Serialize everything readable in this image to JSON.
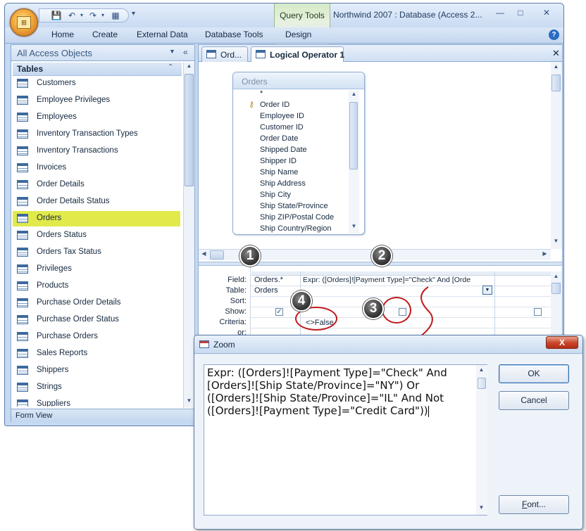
{
  "app": {
    "title": "Northwind 2007 : Database (Access 2...",
    "contextual_tab": "Query Tools",
    "ribbon_tabs": [
      "Home",
      "Create",
      "External Data",
      "Database Tools",
      "Design"
    ],
    "window_controls": {
      "minimize": "—",
      "maximize": "□",
      "close": "✕"
    },
    "help": "?"
  },
  "nav": {
    "title": "All Access Objects",
    "group": "Tables",
    "items": [
      {
        "label": "Customers",
        "selected": false
      },
      {
        "label": "Employee Privileges",
        "selected": false
      },
      {
        "label": "Employees",
        "selected": false
      },
      {
        "label": "Inventory Transaction Types",
        "selected": false
      },
      {
        "label": "Inventory Transactions",
        "selected": false
      },
      {
        "label": "Invoices",
        "selected": false
      },
      {
        "label": "Order Details",
        "selected": false
      },
      {
        "label": "Order Details Status",
        "selected": false
      },
      {
        "label": "Orders",
        "selected": true
      },
      {
        "label": "Orders Status",
        "selected": false
      },
      {
        "label": "Orders Tax Status",
        "selected": false
      },
      {
        "label": "Privileges",
        "selected": false
      },
      {
        "label": "Products",
        "selected": false
      },
      {
        "label": "Purchase Order Details",
        "selected": false
      },
      {
        "label": "Purchase Order Status",
        "selected": false
      },
      {
        "label": "Purchase Orders",
        "selected": false
      },
      {
        "label": "Sales Reports",
        "selected": false
      },
      {
        "label": "Shippers",
        "selected": false
      },
      {
        "label": "Strings",
        "selected": false
      },
      {
        "label": "Suppliers",
        "selected": false
      }
    ],
    "status": "Form View"
  },
  "doc_tabs": [
    {
      "label": "Ord...",
      "active": false
    },
    {
      "label": "Logical Operator 1",
      "active": true
    }
  ],
  "field_list": {
    "title": "Orders",
    "fields": [
      "*",
      "Order ID",
      "Employee ID",
      "Customer ID",
      "Order Date",
      "Shipped Date",
      "Shipper ID",
      "Ship Name",
      "Ship Address",
      "Ship City",
      "Ship State/Province",
      "Ship ZIP/Postal Code",
      "Ship Country/Region"
    ]
  },
  "qbe": {
    "row_labels": [
      "Field:",
      "Table:",
      "Sort:",
      "Show:",
      "Criteria:",
      "or:"
    ],
    "col1": {
      "field": "Orders.*",
      "table": "Orders",
      "show": true,
      "criteria": ""
    },
    "col2": {
      "field": "Expr: ([Orders]![Payment Type]=\"Check\" And [Orde",
      "table": "",
      "show": false,
      "criteria": "<>False"
    },
    "col3": {
      "show": false
    }
  },
  "callouts": [
    "1",
    "2",
    "3",
    "4"
  ],
  "zoom": {
    "title": "Zoom",
    "close": "X",
    "expression": "Expr: ([Orders]![Payment Type]=\"Check\" And [Orders]![Ship State/Province]=\"NY\") Or ([Orders]![Ship State/Province]=\"IL\" And Not ([Orders]![Payment Type]=\"Credit Card\"))",
    "ok_label": "OK",
    "cancel_label": "Cancel",
    "font_label_prefix": "F",
    "font_label_rest": "ont..."
  }
}
